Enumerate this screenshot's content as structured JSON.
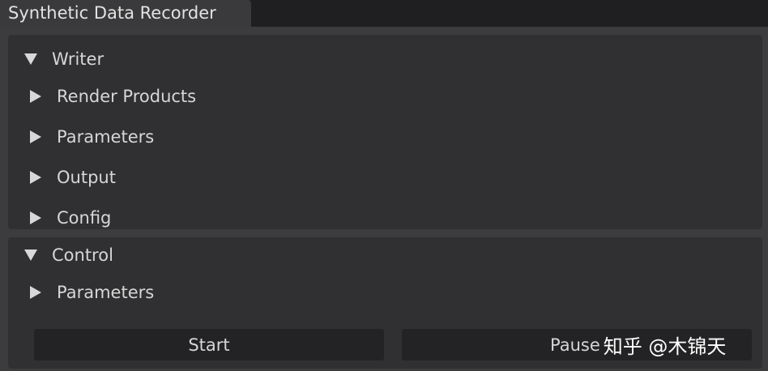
{
  "window": {
    "title": "Synthetic Data Recorder"
  },
  "writer": {
    "label": "Writer",
    "items": [
      {
        "label": "Render Products"
      },
      {
        "label": "Parameters"
      },
      {
        "label": "Output"
      },
      {
        "label": "Config"
      }
    ]
  },
  "control": {
    "label": "Control",
    "parameters_label": "Parameters",
    "start_label": "Start",
    "pause_label": "Pause"
  },
  "watermark": {
    "text": "知乎 @木锦天"
  },
  "icons": {
    "expanded": "caret-down-icon",
    "collapsed": "caret-right-icon"
  },
  "colors": {
    "window_background": "#3c3c3e",
    "frame_background": "#303032",
    "button_background": "#232325",
    "text": "#d6d6d6"
  }
}
